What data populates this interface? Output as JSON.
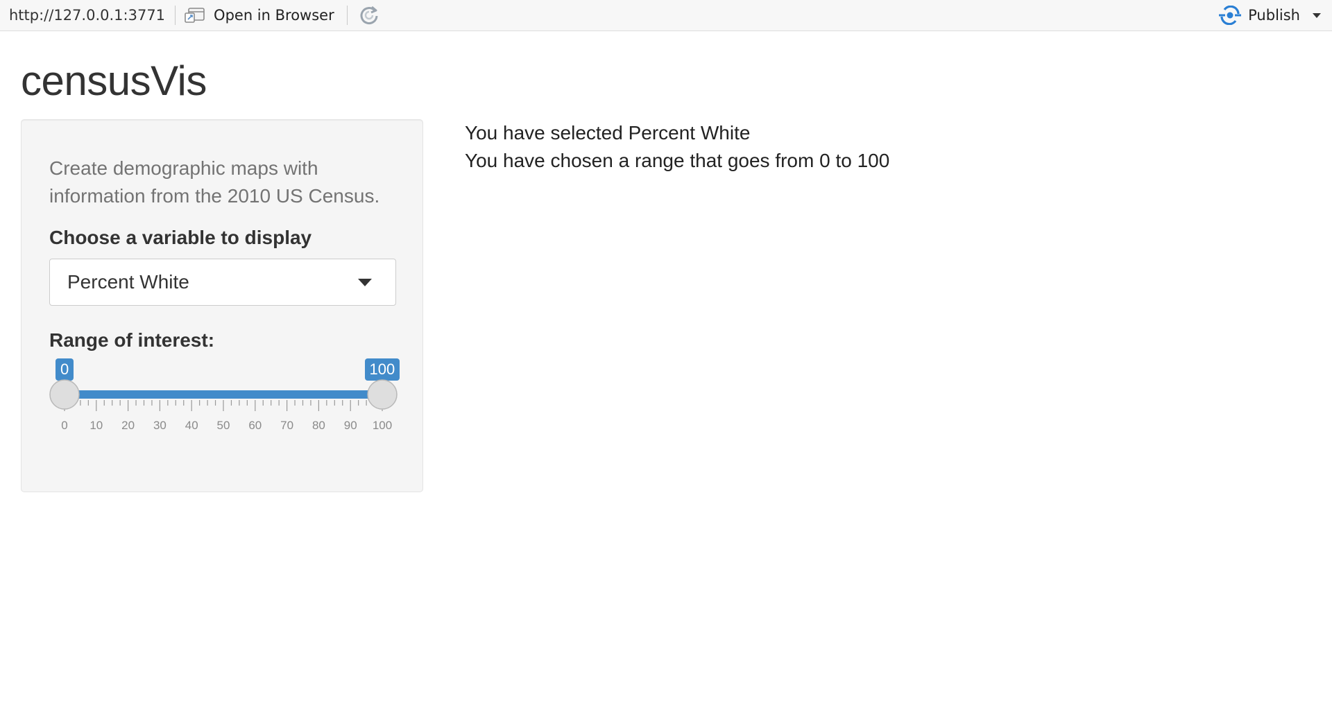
{
  "toolbar": {
    "url": "http://127.0.0.1:3771",
    "open_in_browser_label": "Open in Browser",
    "publish_label": "Publish",
    "accent": "#2a7fd4"
  },
  "app": {
    "title": "censusVis",
    "help_text": "Create demographic maps with information from the 2010 US Census.",
    "variable_select": {
      "label": "Choose a variable to display",
      "value": "Percent White"
    },
    "range_slider": {
      "label": "Range of interest:",
      "min": 0,
      "max": 100,
      "low": 0,
      "high": 100,
      "low_label": "0",
      "high_label": "100",
      "tick_labels": [
        "0",
        "10",
        "20",
        "30",
        "40",
        "50",
        "60",
        "70",
        "80",
        "90",
        "100"
      ],
      "bar_color": "#428bca"
    },
    "output": {
      "line1": "You have selected Percent White",
      "line2": "You have chosen a range that goes from 0 to 100"
    }
  }
}
